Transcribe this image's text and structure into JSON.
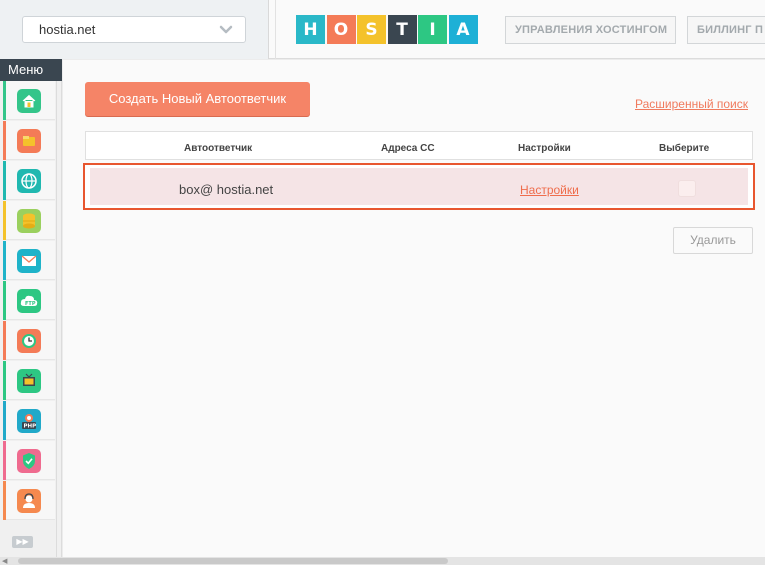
{
  "header": {
    "domain_select": {
      "value": "hostia.net"
    },
    "logo_letters": [
      "H",
      "O",
      "S",
      "T",
      "I",
      "A"
    ],
    "logo_colors": [
      "#2ab8c8",
      "#f47b57",
      "#f4c22b",
      "#3a4650",
      "#2dc783",
      "#1eb0d6"
    ],
    "nav": [
      {
        "label": "УПРАВЛЕНИЯ ХОСТИНГОМ"
      },
      {
        "label": "БИЛЛИНГ П"
      }
    ]
  },
  "sidebar": {
    "title": "Меню",
    "items": [
      {
        "icon": "home-icon",
        "color": "#34c58a",
        "bar": "#34c58a"
      },
      {
        "icon": "folder-icon",
        "color": "#f47b57",
        "bar": "#f47b57"
      },
      {
        "icon": "globe-icon",
        "color": "#20b8b0",
        "bar": "#20b8b0"
      },
      {
        "icon": "database-icon",
        "color": "#9bd05e",
        "bar": "#f4c22b"
      },
      {
        "icon": "mail-icon",
        "color": "#1fb3c9",
        "bar": "#1fb3c9"
      },
      {
        "icon": "ftp-cloud-icon",
        "color": "#2dc783",
        "bar": "#2dc783"
      },
      {
        "icon": "clock-icon",
        "color": "#f47b57",
        "bar": "#f47b57"
      },
      {
        "icon": "monitor-icon",
        "color": "#2dc783",
        "bar": "#2dc783"
      },
      {
        "icon": "php-icon",
        "color": "#21a9c9",
        "bar": "#21a9c9"
      },
      {
        "icon": "shield-icon",
        "color": "#ef6b8f",
        "bar": "#ef6b8f"
      },
      {
        "icon": "user-support-icon",
        "color": "#f5894f",
        "bar": "#f5894f"
      }
    ]
  },
  "main": {
    "create_button": "Создать Новый Автоответчик",
    "advanced_search": "Расширенный поиск",
    "table": {
      "columns": [
        "Автоответчик",
        "Адреса СС",
        "Настройки",
        "Выберите"
      ],
      "rows": [
        {
          "autoresponder": "box@ hostia.net",
          "cc": "",
          "settings": "Настройки"
        }
      ]
    },
    "delete_button": "Удалить"
  }
}
